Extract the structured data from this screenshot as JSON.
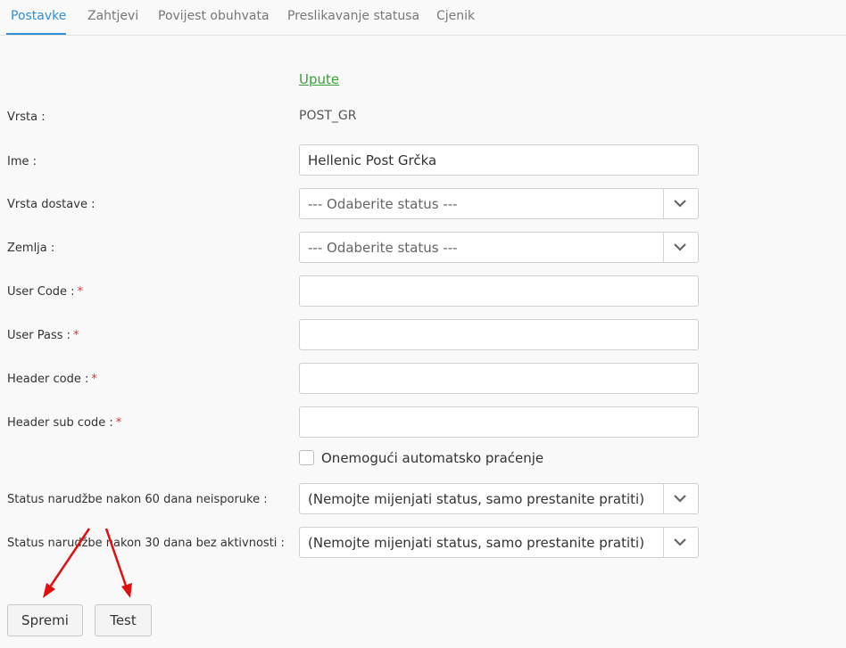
{
  "tabs": [
    {
      "label": "Postavke",
      "active": true
    },
    {
      "label": "Zahtjevi",
      "active": false
    },
    {
      "label": "Povijest obuhvata",
      "active": false
    },
    {
      "label": "Preslikavanje statusa",
      "active": false
    },
    {
      "label": "Cjenik",
      "active": false
    }
  ],
  "help_link": "Upute",
  "form": {
    "vrsta": {
      "label": "Vrsta :",
      "value": "POST_GR"
    },
    "ime": {
      "label": "Ime :",
      "value": "Hellenic Post Grčka"
    },
    "vrsta_dostave": {
      "label": "Vrsta dostave :",
      "selected": "--- Odaberite status ---"
    },
    "zemlja": {
      "label": "Zemlja :",
      "selected": "--- Odaberite status ---"
    },
    "user_code": {
      "label": "User Code :",
      "required": "*",
      "value": ""
    },
    "user_pass": {
      "label": "User Pass :",
      "required": "*",
      "value": ""
    },
    "header_code": {
      "label": "Header code :",
      "required": "*",
      "value": ""
    },
    "header_sub_code": {
      "label": "Header sub code :",
      "required": "*",
      "value": ""
    },
    "disable_tracking": {
      "label": "Onemogući automatsko praćenje",
      "checked": false
    },
    "status_60": {
      "label": "Status narudžbe nakon 60 dana neisporuke :",
      "selected": "(Nemojte mijenjati status, samo prestanite pratiti)"
    },
    "status_30": {
      "label": "Status narudžbe nakon 30 dana bez aktivnosti :",
      "selected": "(Nemojte mijenjati status, samo prestanite pratiti)"
    }
  },
  "buttons": {
    "save": "Spremi",
    "test": "Test"
  },
  "colors": {
    "accent": "#2f8fd4",
    "link": "#3aa13a",
    "required": "#d33333",
    "annotation_arrow": "#e01010"
  },
  "icons": {
    "select_arrow": "chevron-down-icon",
    "annotation": "red-arrow"
  }
}
